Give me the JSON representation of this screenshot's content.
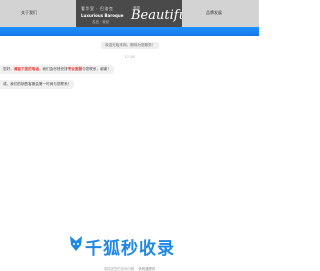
{
  "header": {
    "left_link": "关于我们",
    "right_link": "品牌发展",
    "logo": {
      "cn_text": "奢华室 · 巴洛克",
      "en_text": "Luxurious Baroque",
      "sub_text": "名品 · 家纺",
      "script_text": "Beautiful",
      "tag_text": "美丽"
    }
  },
  "chat": {
    "system_bubble": "欢迎光临本网，期待为您服务！",
    "time": "17:18",
    "messages": [
      {
        "prefix": "您好，",
        "highlight1": "请留下您的电话",
        "middle": "，我们会尽快安排",
        "highlight2": "专业客服",
        "suffix": "与您联系，谢谢！"
      },
      {
        "text": "或，我们的销售客服会第一时间与您联系！"
      }
    ]
  },
  "watermark": {
    "text": "千狐秒收录"
  },
  "footer": {
    "note": "请描述您的咨询问题",
    "tech": "快商通提供"
  },
  "colors": {
    "accent_blue": "#1e88e5",
    "highlight_red": "#e53935"
  }
}
